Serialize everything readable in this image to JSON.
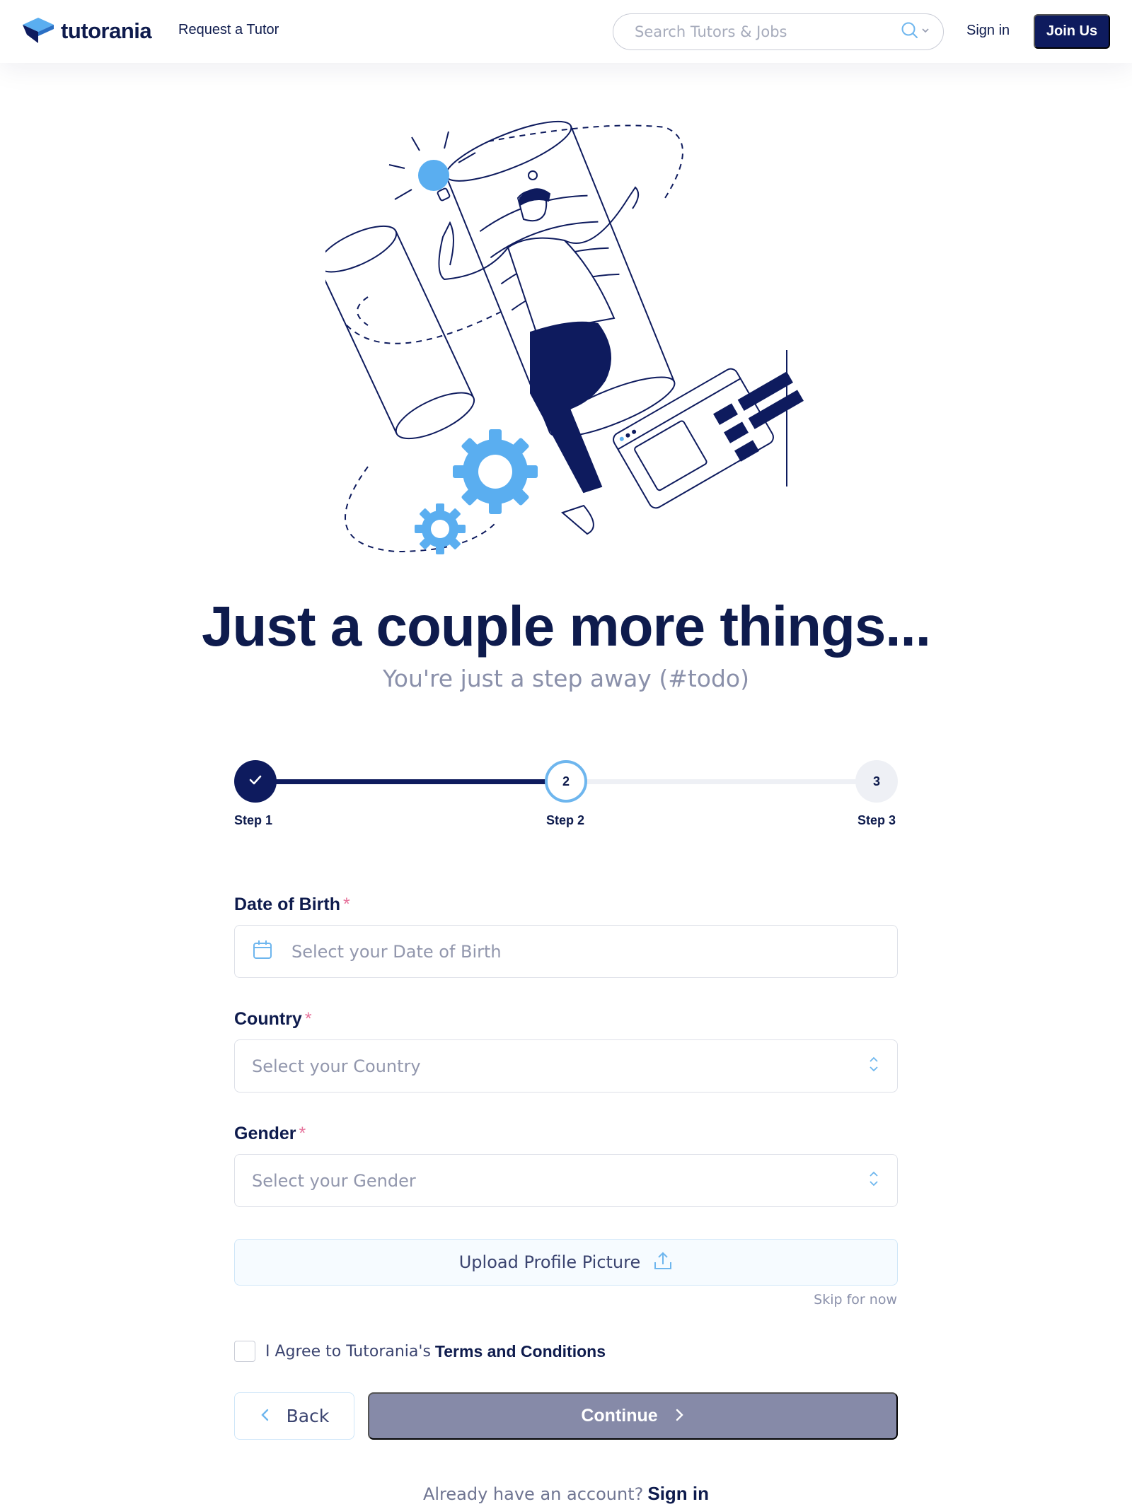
{
  "header": {
    "logo_text": "tutorania",
    "request_link": "Request a Tutor",
    "search_placeholder": "Search Tutors & Jobs",
    "signin_label": "Sign in",
    "join_label": "Join Us"
  },
  "hero": {
    "title": "Just a couple more things...",
    "subtitle": "You're just a step away (#todo)"
  },
  "stepper": {
    "steps": [
      {
        "label": "Step 1",
        "number": "",
        "state": "complete"
      },
      {
        "label": "Step 2",
        "number": "2",
        "state": "current"
      },
      {
        "label": "Step 3",
        "number": "3",
        "state": "upcoming"
      }
    ]
  },
  "form": {
    "dob": {
      "label": "Date of Birth",
      "required_mark": "*",
      "placeholder": "Select your Date of Birth"
    },
    "country": {
      "label": "Country",
      "required_mark": "*",
      "placeholder": "Select your Country"
    },
    "gender": {
      "label": "Gender",
      "required_mark": "*",
      "placeholder": "Select your Gender"
    },
    "upload_label": "Upload Profile Picture",
    "skip_label": "Skip for now",
    "agree_text": "I Agree to Tutorania's",
    "agree_link": "Terms and Conditions",
    "back_label": "Back",
    "continue_label": "Continue"
  },
  "footer": {
    "already_text": "Already have an account?",
    "signin_link": "Sign in"
  },
  "colors": {
    "navy": "#0e1b5e",
    "accent_blue": "#6eb6ee",
    "required_pink": "#e6739b",
    "continue_disabled": "#868aa8"
  }
}
